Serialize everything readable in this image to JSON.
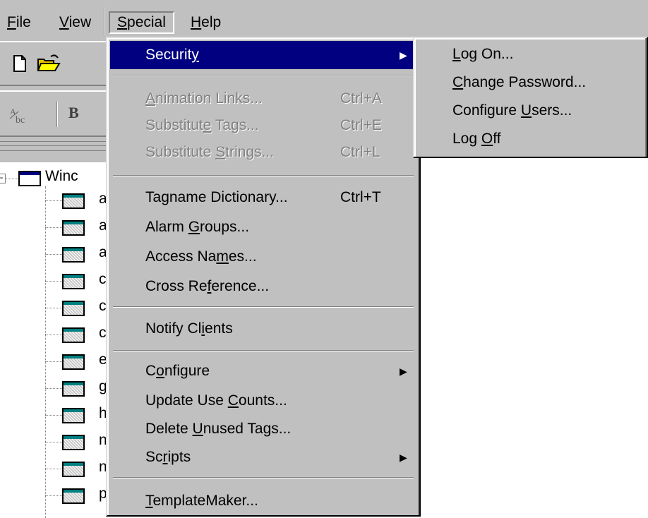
{
  "menubar": {
    "items": [
      {
        "label": "File",
        "u": "F",
        "rest": "ile"
      },
      {
        "label": "View",
        "u": "V",
        "rest": "iew"
      },
      {
        "label": "Special",
        "u": "S",
        "rest": "pecial"
      },
      {
        "label": "Help",
        "u": "H",
        "rest": "elp"
      }
    ]
  },
  "tree": {
    "root_label": "Winc",
    "item_labels": [
      "a",
      "a",
      "a",
      "c",
      "c",
      "c",
      "e",
      "g",
      "h",
      "n",
      "n",
      "p"
    ]
  },
  "menu": {
    "security": {
      "pre": "Securit",
      "u": "y",
      "post": "",
      "arrow": "▶"
    },
    "animation_links": {
      "pre": "",
      "u": "A",
      "post": "nimation Links...",
      "accel": "Ctrl+A"
    },
    "substitute_tags": {
      "pre": "Substitut",
      "u": "e",
      "post": " Tags...",
      "accel": "Ctrl+E"
    },
    "substitute_strings": {
      "pre": "Substitute ",
      "u": "S",
      "post": "trings...",
      "accel": "Ctrl+L"
    },
    "tagname_dictionary": {
      "pre": "Ta",
      "u": "g",
      "post": "name Dictionary...",
      "accel": "Ctrl+T"
    },
    "alarm_groups": {
      "pre": "Alarm ",
      "u": "G",
      "post": "roups..."
    },
    "access_names": {
      "pre": "Access Na",
      "u": "m",
      "post": "es..."
    },
    "cross_reference": {
      "pre": "Cross Re",
      "u": "f",
      "post": "erence..."
    },
    "notify_clients": {
      "pre": "Notify Cl",
      "u": "i",
      "post": "ents"
    },
    "configure": {
      "pre": "C",
      "u": "o",
      "post": "nfigure",
      "arrow": "▶"
    },
    "update_use_counts": {
      "pre": "Update Use ",
      "u": "C",
      "post": "ounts..."
    },
    "delete_unused_tags": {
      "pre": "Delete ",
      "u": "U",
      "post": "nused Tags..."
    },
    "scripts": {
      "pre": "Sc",
      "u": "r",
      "post": "ipts",
      "arrow": "▶"
    },
    "templatemaker": {
      "pre": "",
      "u": "T",
      "post": "emplateMaker..."
    }
  },
  "submenu": {
    "log_on": {
      "pre": "",
      "u": "L",
      "post": "og On..."
    },
    "change_password": {
      "pre": "",
      "u": "C",
      "post": "hange Password..."
    },
    "configure_users": {
      "pre": "Configure ",
      "u": "U",
      "post": "sers..."
    },
    "log_off": {
      "pre": "Log ",
      "u": "O",
      "post": "ff"
    }
  },
  "colors": {
    "menu_bg": "#c0c0c0",
    "highlight": "#000080",
    "disabled_text": "#808080"
  },
  "icons": [
    "new-file-icon",
    "open-folder-icon",
    "text-tool-icon",
    "bold-icon",
    "window-icon",
    "dotted-page-icon",
    "submenu-arrow-icon",
    "tree-collapse-icon"
  ]
}
